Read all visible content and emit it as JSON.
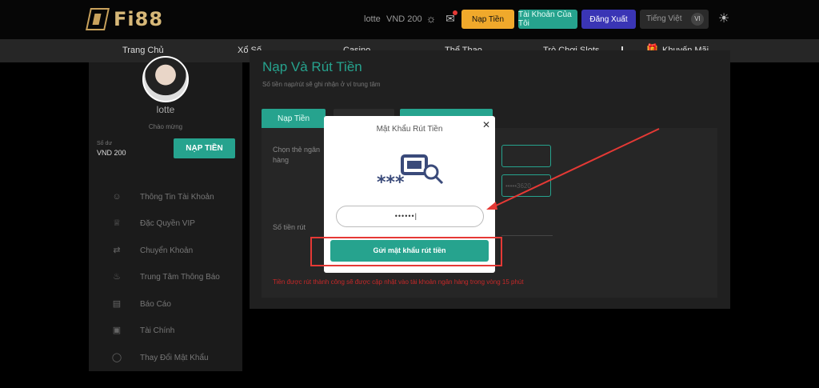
{
  "brand": {
    "logo_text": "Fi88"
  },
  "header": {
    "username": "lotte",
    "balance": "VND 200",
    "deposit_label": "Nạp Tiền",
    "account_label": "Tài Khoản Của Tôi",
    "logout_label": "Đăng Xuất",
    "language": "Tiếng Việt",
    "language_code": "VI",
    "colors": {
      "deposit": "#f0a92b",
      "account": "#26a38e",
      "logout": "#3a35b5"
    }
  },
  "nav": {
    "items": [
      "Trang Chủ",
      "Xổ Số",
      "Casino",
      "Thể Thao",
      "Trò Chơi Slots",
      "Khuyến Mãi"
    ]
  },
  "sidebar": {
    "username": "lotte",
    "greeting": "Chào mừng",
    "balance_label": "Số dư",
    "balance_value": "VND 200",
    "deposit_button": "NẠP TIỀN",
    "menu": [
      {
        "label": "Thông Tin Tài Khoản",
        "icon": "user-icon"
      },
      {
        "label": "Đặc Quyền VIP",
        "icon": "crown-icon"
      },
      {
        "label": "Chuyển Khoản",
        "icon": "transfer-icon"
      },
      {
        "label": "Trung Tâm Thông Báo",
        "icon": "bell-icon"
      },
      {
        "label": "Báo Cáo",
        "icon": "document-icon"
      },
      {
        "label": "Tài Chính",
        "icon": "money-icon"
      },
      {
        "label": "Thay Đổi Mật Khẩu",
        "icon": "shield-icon"
      }
    ]
  },
  "main": {
    "title": "Nạp Và Rút Tiền",
    "subtitle": "Số tiền nạp/rút sẽ ghi nhận ở ví trung tâm",
    "tabs": [
      "Nạp Tiền"
    ],
    "bank_label": "Chọn thẻ ngân hàng",
    "account_placeholder": "•••••3620",
    "amount_label": "Số tiền rút",
    "notice": "Tiền được rút thành công sẽ được cập nhật vào tài khoản ngân hàng trong vòng 15 phút"
  },
  "modal": {
    "title": "Mật Khẩu Rút Tiền",
    "password_value": "••••••|",
    "submit_label": "Gửi mật khẩu rút tiền"
  },
  "annotation": {
    "color": "#e53935"
  }
}
